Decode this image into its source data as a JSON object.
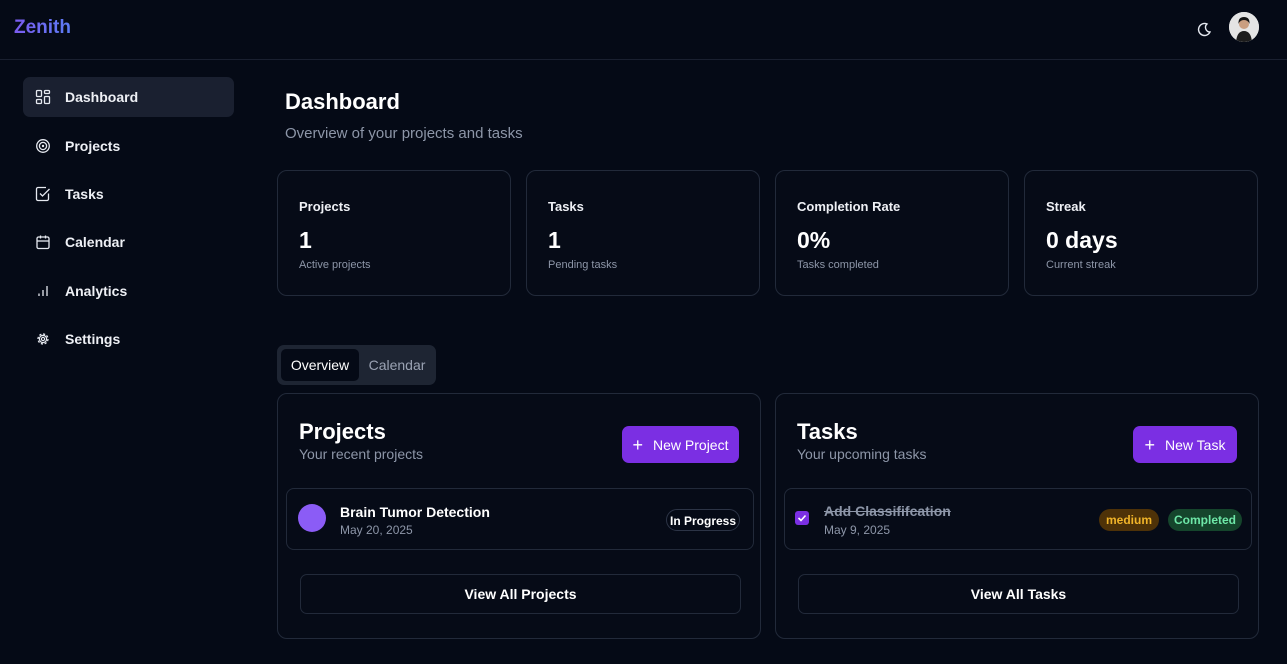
{
  "app": {
    "brand": "Zenith"
  },
  "colors": {
    "accent": "#7b2fe3",
    "brand": "#7c5cf0",
    "project_dot": "#8b5cf6",
    "medium": "#d9890a",
    "completed": "#22c55e"
  },
  "sidebar": {
    "items": [
      {
        "label": "Dashboard",
        "icon": "layout-grid-icon",
        "active": true
      },
      {
        "label": "Projects",
        "icon": "target-icon"
      },
      {
        "label": "Tasks",
        "icon": "check-square-icon"
      },
      {
        "label": "Calendar",
        "icon": "calendar-icon"
      },
      {
        "label": "Analytics",
        "icon": "bar-chart-icon"
      },
      {
        "label": "Settings",
        "icon": "gear-icon"
      }
    ]
  },
  "header": {
    "title": "Dashboard",
    "subtitle": "Overview of your projects and tasks"
  },
  "stats": [
    {
      "title": "Projects",
      "value": "1",
      "sub": "Active projects"
    },
    {
      "title": "Tasks",
      "value": "1",
      "sub": "Pending tasks"
    },
    {
      "title": "Completion Rate",
      "value": "0%",
      "sub": "Tasks completed"
    },
    {
      "title": "Streak",
      "value": "0 days",
      "sub": "Current streak"
    }
  ],
  "tabs": [
    {
      "label": "Overview",
      "active": true
    },
    {
      "label": "Calendar"
    }
  ],
  "projects_panel": {
    "title": "Projects",
    "subtitle": "Your recent projects",
    "new_label": "New Project",
    "items": [
      {
        "name": "Brain Tumor Detection",
        "date": "May 20, 2025",
        "status": "In Progress"
      }
    ],
    "view_all": "View All Projects"
  },
  "tasks_panel": {
    "title": "Tasks",
    "subtitle": "Your upcoming tasks",
    "new_label": "New Task",
    "items": [
      {
        "name": "Add Classififcation",
        "date": "May 9, 2025",
        "priority": "medium",
        "status": "Completed",
        "checked": true
      }
    ],
    "view_all": "View All Tasks"
  }
}
